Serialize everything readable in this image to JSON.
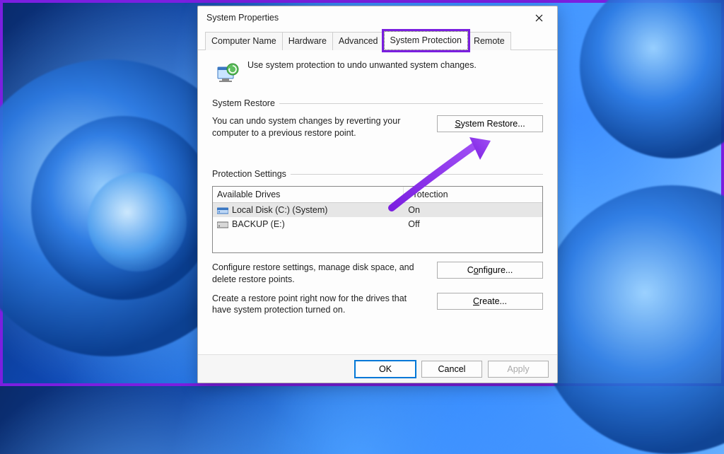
{
  "dialog": {
    "title": "System Properties",
    "tabs": [
      "Computer Name",
      "Hardware",
      "Advanced",
      "System Protection",
      "Remote"
    ],
    "active_tab": 3,
    "intro_text": "Use system protection to undo unwanted system changes."
  },
  "system_restore": {
    "group_label": "System Restore",
    "description": "You can undo system changes by reverting your computer to a previous restore point.",
    "button": "System Restore..."
  },
  "protection_settings": {
    "group_label": "Protection Settings",
    "columns": {
      "drives": "Available Drives",
      "protection": "Protection"
    },
    "rows": [
      {
        "name": "Local Disk (C:) (System)",
        "status": "On",
        "selected": true,
        "icon": "system-disk"
      },
      {
        "name": "BACKUP (E:)",
        "status": "Off",
        "selected": false,
        "icon": "disk"
      }
    ],
    "configure_text": "Configure restore settings, manage disk space, and delete restore points.",
    "configure_button": "Configure...",
    "create_text": "Create a restore point right now for the drives that have system protection turned on.",
    "create_button": "Create..."
  },
  "footer": {
    "ok": "OK",
    "cancel": "Cancel",
    "apply": "Apply"
  },
  "annotation": {
    "color": "#7b1fe0"
  }
}
